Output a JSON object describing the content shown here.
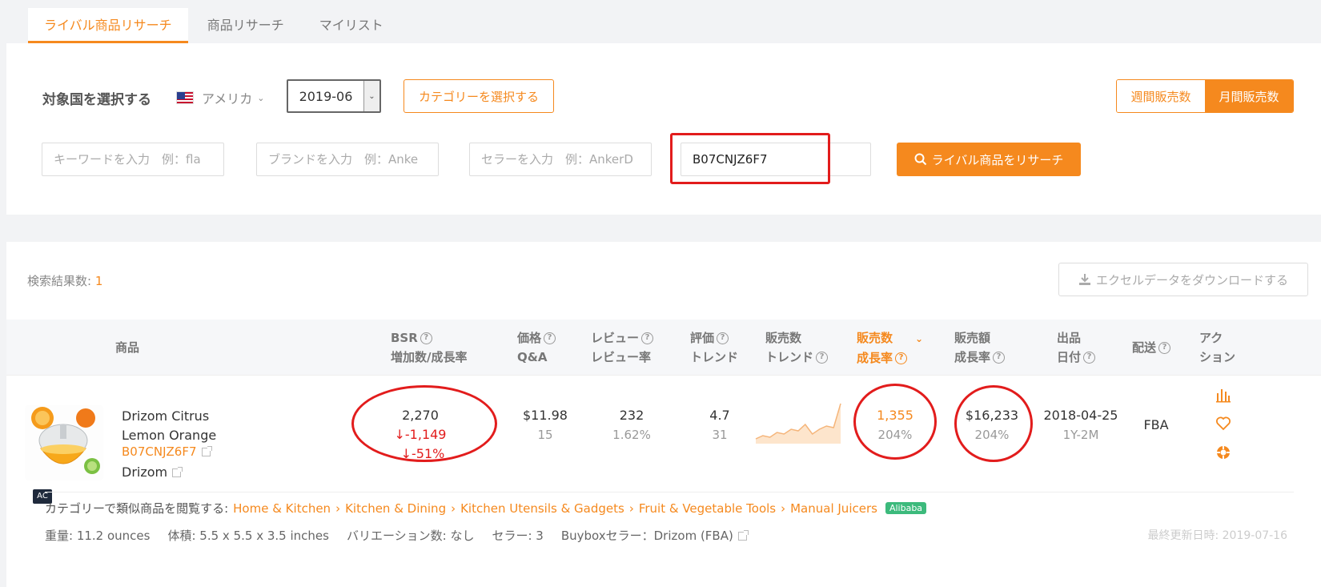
{
  "tabs": [
    {
      "label": "ライバル商品リサーチ",
      "active": true
    },
    {
      "label": "商品リサーチ",
      "active": false
    },
    {
      "label": "マイリスト",
      "active": false
    }
  ],
  "filters": {
    "country_label": "対象国を選択する",
    "country_value": "アメリカ",
    "date_value": "2019-06",
    "category_button": "カテゴリーを選択する",
    "weekly_sales": "週間販売数",
    "monthly_sales": "月間販売数",
    "keyword_placeholder": "キーワードを入力　例：fla",
    "brand_placeholder": "ブランドを入力　例：Anke",
    "seller_placeholder": "セラーを入力　例：AnkerD",
    "asin_value": "B07CNJZ6F7",
    "search_button": "ライバル商品をリサーチ"
  },
  "results": {
    "count_label": "検索結果数:",
    "count_value": "1",
    "download_button": "エクセルデータをダウンロードする"
  },
  "columns": {
    "product": "商品",
    "bsr_1": "BSR",
    "bsr_2": "増加数/成長率",
    "price_1": "価格",
    "price_2": "Q&A",
    "review_1": "レビュー",
    "review_2": "レビュー率",
    "rating_1": "評価",
    "rating_2": "トレンド",
    "sales_trend_1": "販売数",
    "sales_trend_2": "トレンド",
    "sales_growth_1": "販売数",
    "sales_growth_2": "成長率",
    "revenue_1": "販売額",
    "revenue_2": "成長率",
    "listing_1": "出品",
    "listing_2": "日付",
    "shipping": "配送",
    "action_1": "アク",
    "action_2": "ション"
  },
  "row": {
    "badge": "AC",
    "name": "Drizom Citrus Lemon Orange",
    "asin": "B07CNJZ6F7",
    "brand": "Drizom",
    "bsr": "2,270",
    "bsr_change": "-1,149",
    "bsr_rate": "-51%",
    "price": "$11.98",
    "qa": "15",
    "reviews": "232",
    "review_rate": "1.62%",
    "rating": "4.7",
    "rating_trend": "31",
    "sales": "1,355",
    "sales_growth": "204%",
    "revenue": "$16,233",
    "revenue_growth": "204%",
    "listing_date": "2018-04-25",
    "listing_age": "1Y-2M",
    "shipping": "FBA",
    "sparkline": [
      3,
      5,
      4,
      7,
      6,
      9,
      8,
      12,
      6,
      9,
      11,
      10,
      25
    ],
    "category_prefix": "カテゴリーで類似商品を閲覧する:",
    "categories": [
      "Home & Kitchen",
      "Kitchen & Dining",
      "Kitchen Utensils & Gadgets",
      "Fruit & Vegetable Tools",
      "Manual Juicers"
    ],
    "alibaba": "Alibaba",
    "weight": "重量: 11.2 ounces",
    "volume": "体積: 5.5 x 5.5 x 3.5 inches",
    "variation": "バリエーション数: なし",
    "sellers": "セラー: 3",
    "buybox": "Buyboxセラー：Drizom (FBA)",
    "updated": "最終更新日時: 2019-07-16"
  },
  "colors": {
    "accent": "#f5891e",
    "annotation": "#e21c1c",
    "alibaba": "#3cba7c"
  }
}
